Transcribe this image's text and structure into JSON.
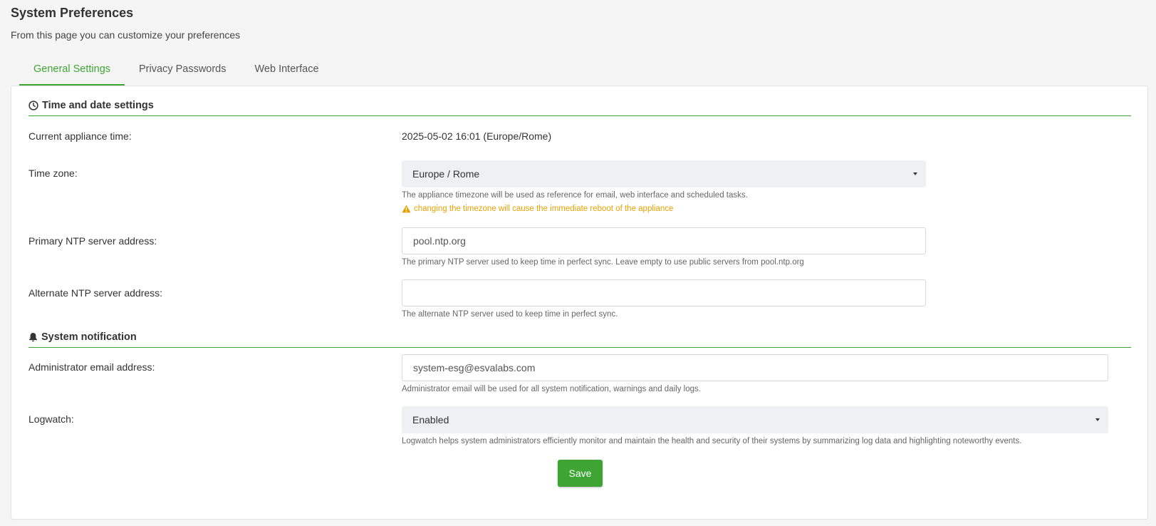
{
  "page": {
    "title": "System Preferences",
    "subtitle": "From this page you can customize your preferences"
  },
  "tabs": [
    {
      "label": "General Settings",
      "active": true
    },
    {
      "label": "Privacy Passwords",
      "active": false
    },
    {
      "label": "Web Interface",
      "active": false
    }
  ],
  "time_section": {
    "title": "Time and date settings",
    "icon": "clock-icon",
    "current_time_label": "Current appliance time:",
    "current_time_value": "2025-05-02 16:01 (Europe/Rome)",
    "timezone_label": "Time zone:",
    "timezone_value": "Europe / Rome",
    "timezone_help": "The appliance timezone will be used as reference for email, web interface and scheduled tasks.",
    "timezone_warning": "changing the timezone will cause the immediate reboot of the appliance",
    "primary_ntp_label": "Primary NTP server address:",
    "primary_ntp_value": "pool.ntp.org",
    "primary_ntp_help": "The primary NTP server used to keep time in perfect sync. Leave empty to use public servers from pool.ntp.org",
    "alternate_ntp_label": "Alternate NTP server address:",
    "alternate_ntp_value": "",
    "alternate_ntp_help": "The alternate NTP server used to keep time in perfect sync."
  },
  "notification_section": {
    "title": "System notification",
    "icon": "bell-icon",
    "admin_email_label": "Administrator email address:",
    "admin_email_value": "system-esg@esvalabs.com",
    "admin_email_help": "Administrator email will be used for all system notification, warnings and daily logs.",
    "logwatch_label": "Logwatch:",
    "logwatch_value": "Enabled",
    "logwatch_help": "Logwatch helps system administrators efficiently monitor and maintain the health and security of their systems by summarizing log data and highlighting noteworthy events."
  },
  "actions": {
    "save_label": "Save"
  },
  "colors": {
    "accent": "#3ea534",
    "warning": "#e8a200",
    "select_bg": "#eef0f4"
  }
}
